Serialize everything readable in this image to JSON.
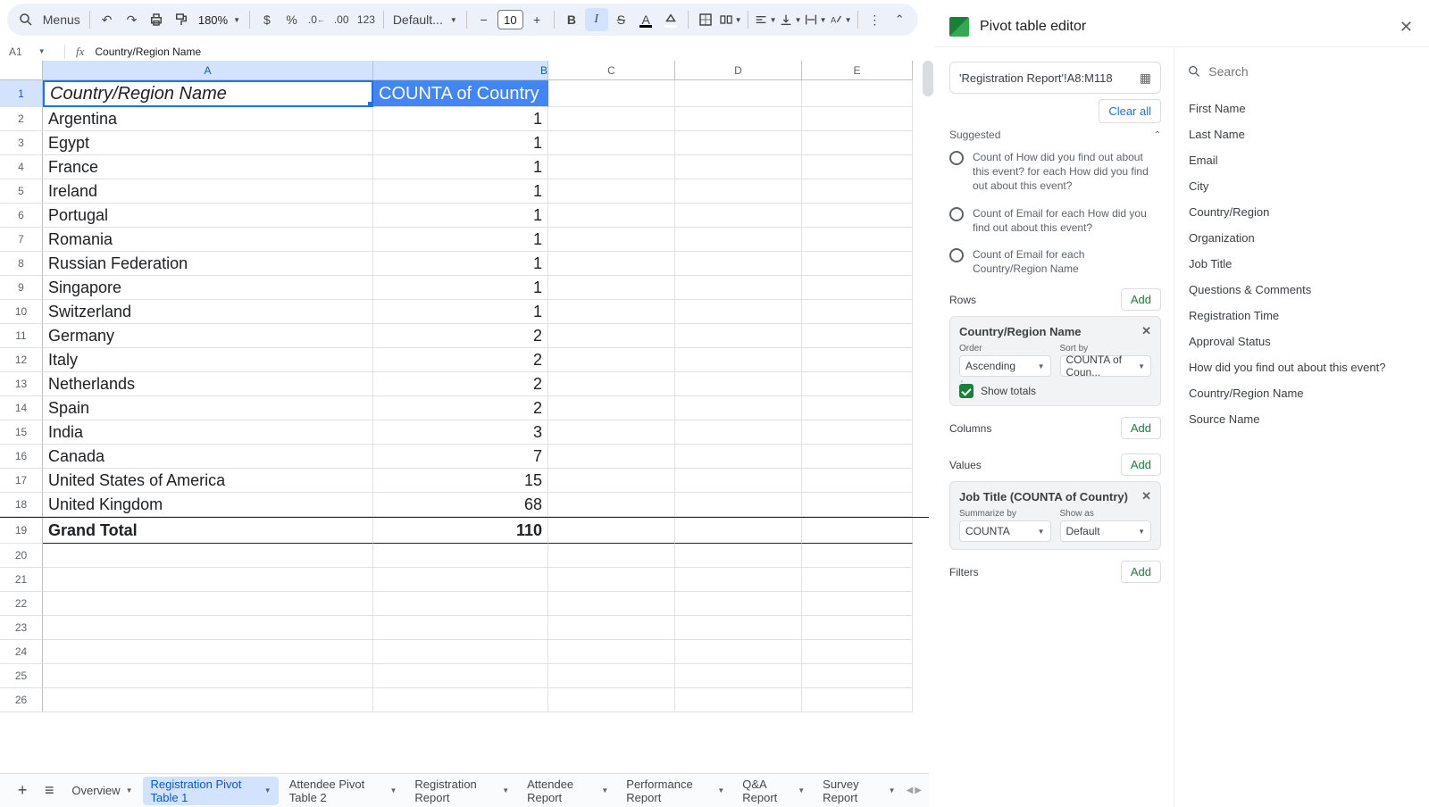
{
  "toolbar": {
    "menus_label": "Menus",
    "zoom": "180%",
    "number_123": "123",
    "font_name": "Default...",
    "font_size": "10"
  },
  "namebox": "A1",
  "formula_value": "Country/Region Name",
  "columns": [
    "A",
    "B",
    "C",
    "D",
    "E"
  ],
  "header_A": "Country/Region Name",
  "header_B": "COUNTA of Country",
  "data_rows": [
    {
      "country": "Argentina",
      "count": "1"
    },
    {
      "country": "Egypt",
      "count": "1"
    },
    {
      "country": "France",
      "count": "1"
    },
    {
      "country": "Ireland",
      "count": "1"
    },
    {
      "country": "Portugal",
      "count": "1"
    },
    {
      "country": "Romania",
      "count": "1"
    },
    {
      "country": "Russian Federation",
      "count": "1"
    },
    {
      "country": "Singapore",
      "count": "1"
    },
    {
      "country": "Switzerland",
      "count": "1"
    },
    {
      "country": "Germany",
      "count": "2"
    },
    {
      "country": "Italy",
      "count": "2"
    },
    {
      "country": "Netherlands",
      "count": "2"
    },
    {
      "country": "Spain",
      "count": "2"
    },
    {
      "country": "India",
      "count": "3"
    },
    {
      "country": "Canada",
      "count": "7"
    },
    {
      "country": "United States of America",
      "count": "15"
    },
    {
      "country": "United Kingdom",
      "count": "68"
    }
  ],
  "grand_total_label": "Grand Total",
  "grand_total_value": "110",
  "tabs": [
    "Overview",
    "Registration Pivot Table 1",
    "Attendee Pivot Table 2",
    "Registration Report",
    "Attendee Report",
    "Performance Report",
    "Q&A Report",
    "Survey Report"
  ],
  "pivot": {
    "title": "Pivot table editor",
    "range": "'Registration Report'!A8:M118",
    "clear_all": "Clear all",
    "suggested_label": "Suggested",
    "suggestions": [
      "Count of How did you find out about this event? for each How did you find out about this event?",
      "Count of Email for each How did you find out about this event?",
      "Count of Email for each Country/Region Name"
    ],
    "rows_label": "Rows",
    "columns_label": "Columns",
    "values_label": "Values",
    "filters_label": "Filters",
    "add_label": "Add",
    "row_chip": {
      "title": "Country/Region Name",
      "order_label": "Order",
      "order_value": "Ascending",
      "sortby_label": "Sort by",
      "sortby_value": "COUNTA of Coun...",
      "show_totals": "Show totals"
    },
    "value_chip": {
      "title": "Job Title (COUNTA of Country)",
      "summarize_label": "Summarize by",
      "summarize_value": "COUNTA",
      "showas_label": "Show as",
      "showas_value": "Default"
    },
    "search_placeholder": "Search",
    "fields": [
      "First Name",
      "Last Name",
      "Email",
      "City",
      "Country/Region",
      "Organization",
      "Job Title",
      "Questions & Comments",
      "Registration Time",
      "Approval Status",
      "How did you find out about this event?",
      "Country/Region Name",
      "Source Name"
    ]
  }
}
